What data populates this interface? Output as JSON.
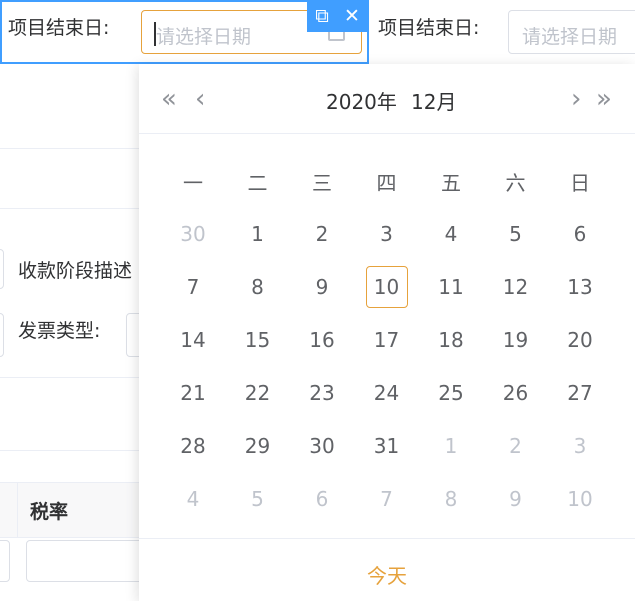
{
  "form": {
    "end_date_label": "项目结束日:",
    "end_date_placeholder": "请选择日期",
    "end_date_label_2": "项目结束日:",
    "end_date_placeholder_2": "请选择日期",
    "payment_stage_label": "收款阶段描述",
    "invoice_type_label": "发票类型:",
    "tax_rate_header": "税率"
  },
  "toolbar": {
    "copy_icon": "copy-icon",
    "close_icon": "close-icon",
    "copy_glyph": "⧉",
    "close_glyph": "✕"
  },
  "picker": {
    "prev_year": "«",
    "prev_month": "‹",
    "next_month": "›",
    "next_year": "»",
    "year_label": "2020年",
    "month_label": "12月",
    "weekdays": [
      "一",
      "二",
      "三",
      "四",
      "五",
      "六",
      "日"
    ],
    "weeks": [
      [
        {
          "d": "30",
          "m": true
        },
        {
          "d": "1"
        },
        {
          "d": "2"
        },
        {
          "d": "3"
        },
        {
          "d": "4"
        },
        {
          "d": "5"
        },
        {
          "d": "6"
        }
      ],
      [
        {
          "d": "7"
        },
        {
          "d": "8"
        },
        {
          "d": "9"
        },
        {
          "d": "10",
          "today": true
        },
        {
          "d": "11"
        },
        {
          "d": "12"
        },
        {
          "d": "13"
        }
      ],
      [
        {
          "d": "14"
        },
        {
          "d": "15"
        },
        {
          "d": "16"
        },
        {
          "d": "17"
        },
        {
          "d": "18"
        },
        {
          "d": "19"
        },
        {
          "d": "20"
        }
      ],
      [
        {
          "d": "21"
        },
        {
          "d": "22"
        },
        {
          "d": "23"
        },
        {
          "d": "24"
        },
        {
          "d": "25"
        },
        {
          "d": "26"
        },
        {
          "d": "27"
        }
      ],
      [
        {
          "d": "28"
        },
        {
          "d": "29"
        },
        {
          "d": "30"
        },
        {
          "d": "31"
        },
        {
          "d": "1",
          "m": true
        },
        {
          "d": "2",
          "m": true
        },
        {
          "d": "3",
          "m": true
        }
      ],
      [
        {
          "d": "4",
          "m": true
        },
        {
          "d": "5",
          "m": true
        },
        {
          "d": "6",
          "m": true
        },
        {
          "d": "7",
          "m": true
        },
        {
          "d": "8",
          "m": true
        },
        {
          "d": "9",
          "m": true
        },
        {
          "d": "10",
          "m": true
        }
      ]
    ],
    "today_label": "今天"
  },
  "colors": {
    "accent": "#409eff",
    "today": "#e6a23c",
    "muted": "#c0c4cc"
  }
}
